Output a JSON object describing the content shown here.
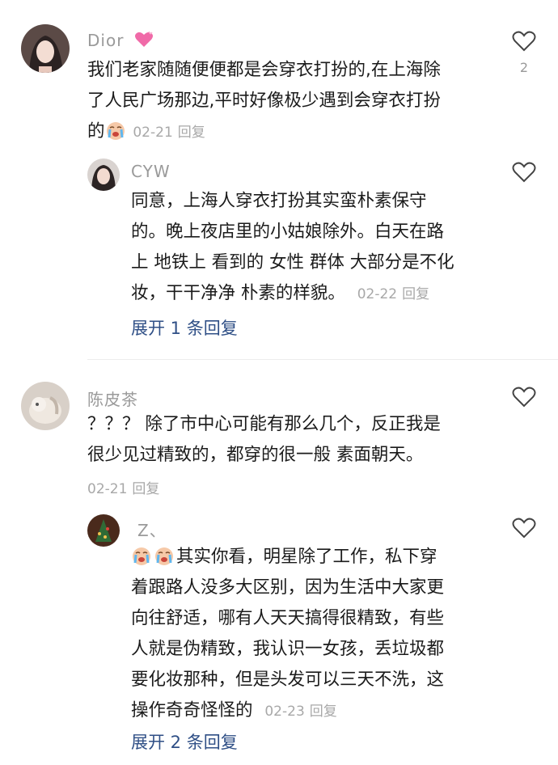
{
  "comments": [
    {
      "username": "Dior",
      "username_emoji": "heart-emoji",
      "text": "我们老家随随便便都是会穿衣打扮的,在上海除了人民广场那边,平时好像极少遇到会穿衣打扮的",
      "lines": [
        "我们老家随随便便都是会穿衣打扮的,在上海除",
        "了人民广场那边,平时好像极少遇到会穿衣打扮",
        "的"
      ],
      "date": "02-21",
      "reply_label": "回复",
      "like_count": "2",
      "replies": [
        {
          "username": "CYW",
          "lines": [
            "同意，上海人穿衣打扮其实蛮朴素保守",
            "的。晚上夜店里的小姑娘除外。白天在路",
            "上 地铁上 看到的 女性 群体 大部分是不化",
            "妆，干干净净 朴素的样貌。"
          ],
          "date": "02-22",
          "reply_label": "回复"
        }
      ],
      "expand_label": "展开 1 条回复"
    },
    {
      "username": "陈皮茶",
      "lines": [
        "？？？ 除了市中心可能有那么几个，反正我是",
        "很少见过精致的，都穿的很一般 素面朝天。"
      ],
      "date": "02-21",
      "reply_label": "回复",
      "replies": [
        {
          "username": "Z、",
          "lines": [
            "其实你看，明星除了工作，私下穿",
            "着跟路人没多大区别，因为生活中大家更",
            "向往舒适，哪有人天天搞得很精致，有些",
            "人就是伪精致，我认识一女孩，丢垃圾都",
            "要化妆那种，但是头发可以三天不洗，这",
            "操作奇奇怪怪的"
          ],
          "date": "02-23",
          "reply_label": "回复"
        }
      ],
      "expand_label": "展开 2 条回复"
    }
  ],
  "colors": {
    "link": "#2f4f86",
    "meta": "#a8a8a8",
    "username": "#9a9a9a"
  }
}
